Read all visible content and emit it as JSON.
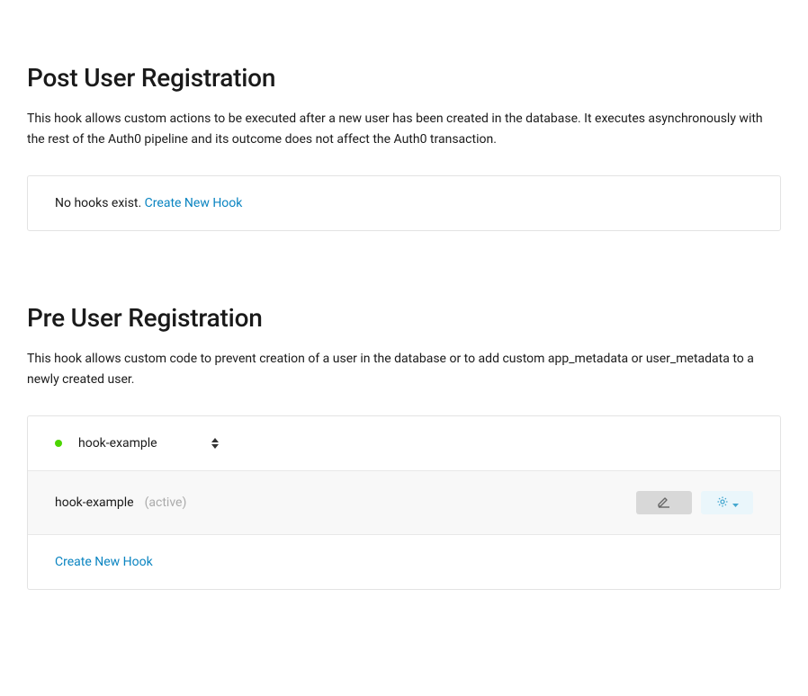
{
  "sections": {
    "post": {
      "title": "Post User Registration",
      "description": "This hook allows custom actions to be executed after a new user has been created in the database. It executes asynchronously with the rest of the Auth0 pipeline and its outcome does not affect the Auth0 transaction.",
      "empty_text": "No hooks exist. ",
      "create_link": "Create New Hook"
    },
    "pre": {
      "title": "Pre User Registration",
      "description": "This hook allows custom code to prevent creation of a user in the database or to add custom app_metadata or user_metadata to a newly created user.",
      "selected_hook": "hook-example",
      "hook": {
        "name": "hook-example",
        "status": "(active)"
      },
      "create_link": "Create New Hook"
    }
  },
  "colors": {
    "link": "#0a84c1",
    "active_dot": "#4cd500",
    "settings_btn_bg": "#eaf6fb",
    "settings_icon": "#44a7cf",
    "edit_btn_bg": "#d8d8d8",
    "edit_icon": "#676767"
  }
}
